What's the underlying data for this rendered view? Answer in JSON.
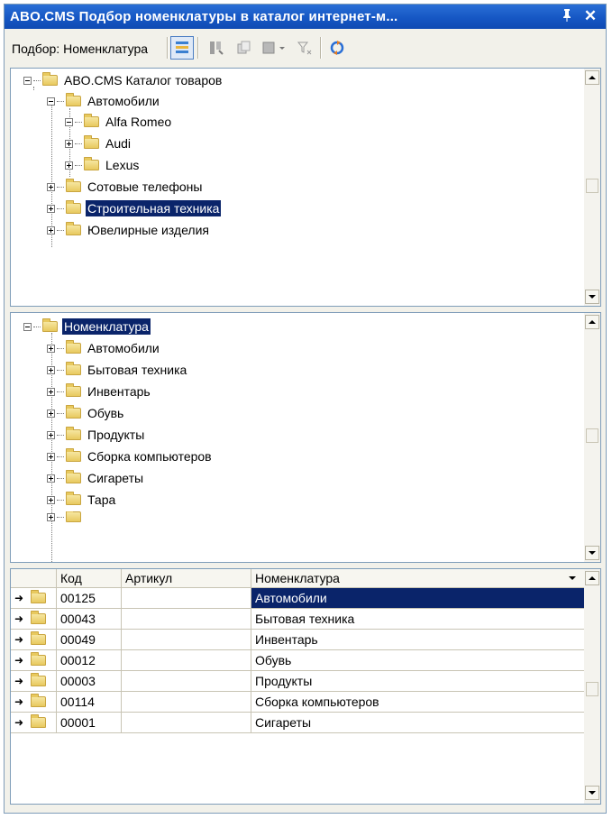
{
  "window": {
    "title": "ABO.CMS Подбор номенклатуры в каталог интернет-м...",
    "pin_glyph": "ᵽ",
    "close_glyph": "✕"
  },
  "toolbar": {
    "label": "Подбор: Номенклатура"
  },
  "catalog_tree": {
    "root": "ABO.CMS Каталог товаров",
    "group_open": "Автомобили",
    "sub": [
      "Alfa Romeo",
      "Audi",
      "Lexus"
    ],
    "items": [
      "Сотовые телефоны",
      "Строительная техника",
      "Ювелирные изделия"
    ],
    "selected": "Строительная техника"
  },
  "nomenclature_tree": {
    "root": "Номенклатура",
    "items": [
      "Автомобили",
      "Бытовая техника",
      "Инвентарь",
      "Обувь",
      "Продукты",
      "Сборка компьютеров",
      "Сигареты",
      "Тара"
    ]
  },
  "table": {
    "columns": [
      "Код",
      "Артикул",
      "Номенклатура"
    ],
    "rows": [
      {
        "code": "00125",
        "article": "",
        "name": "Автомобили"
      },
      {
        "code": "00043",
        "article": "",
        "name": "Бытовая техника"
      },
      {
        "code": "00049",
        "article": "",
        "name": "Инвентарь"
      },
      {
        "code": "00012",
        "article": "",
        "name": "Обувь"
      },
      {
        "code": "00003",
        "article": "",
        "name": "Продукты"
      },
      {
        "code": "00114",
        "article": "",
        "name": "Сборка компьютеров"
      },
      {
        "code": "00001",
        "article": "",
        "name": "Сигареты"
      }
    ],
    "selected_row": 0
  },
  "colors": {
    "title_bar": "#1657c4",
    "selection": "#0a246a",
    "folder": "#e8c95e"
  }
}
